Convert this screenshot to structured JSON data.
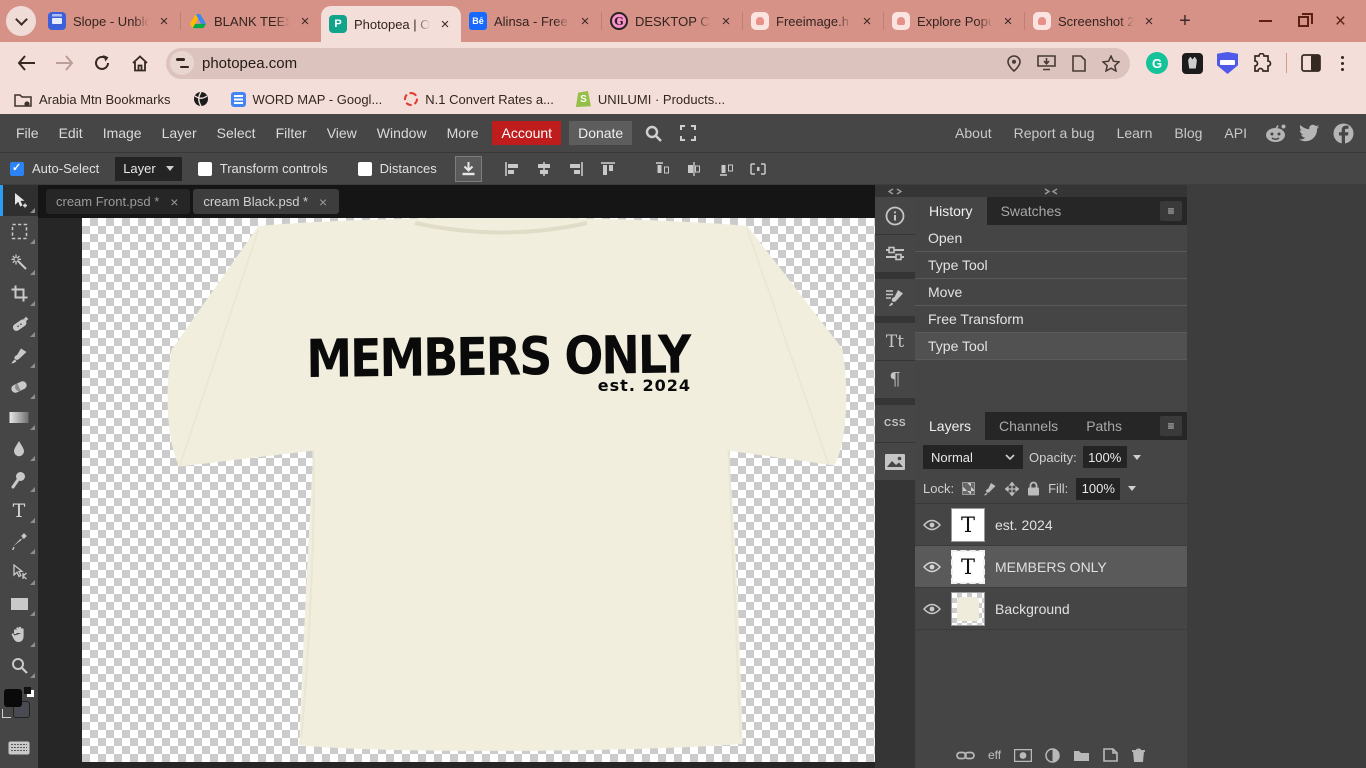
{
  "browser": {
    "tabs": [
      {
        "title": "Slope - Unblo",
        "favicon": "slope"
      },
      {
        "title": "BLANK TEES",
        "favicon": "google-drive"
      },
      {
        "title": "Photopea | O",
        "favicon": "photopea",
        "favicon_letter": "P",
        "active": true
      },
      {
        "title": "Alinsa - Free",
        "favicon": "behance",
        "favicon_letter": "Bē"
      },
      {
        "title": "DESKTOP CO",
        "favicon": "g-circle",
        "favicon_letter": "G"
      },
      {
        "title": "Freeimage.h",
        "favicon": "image"
      },
      {
        "title": "Explore Popu",
        "favicon": "image"
      },
      {
        "title": "Screenshot 2",
        "favicon": "image"
      }
    ],
    "url": "photopea.com",
    "bookmarks": {
      "folder": "Arabia Mtn Bookmarks",
      "items": [
        "WORD MAP - Googl...",
        "N.1 Convert Rates a...",
        "UNILUMI · Products..."
      ],
      "shopify_letter": "S"
    },
    "grammarly_letter": "G"
  },
  "menu": {
    "items": [
      "File",
      "Edit",
      "Image",
      "Layer",
      "Select",
      "Filter",
      "View",
      "Window",
      "More"
    ],
    "account": "Account",
    "donate": "Donate",
    "links": [
      "About",
      "Report a bug",
      "Learn",
      "Blog",
      "API"
    ]
  },
  "options": {
    "auto_select": "Auto-Select",
    "layer_select": "Layer",
    "transform_controls": "Transform controls",
    "distances": "Distances"
  },
  "doc_tabs": [
    {
      "name": "cream Front.psd *"
    },
    {
      "name": "cream Black.psd *",
      "active": true
    }
  ],
  "canvas": {
    "shirt_title": "MEMBERS ONLY",
    "shirt_subtitle": "est. 2024",
    "shirt_color": "#f1eedd"
  },
  "tools_panel": {
    "type_tool_letter": "T",
    "char_panel_label": "Tt",
    "paragraph_label": "¶",
    "css_label": "CSS"
  },
  "history": {
    "tabs": [
      "History",
      "Swatches"
    ],
    "items": [
      "Open",
      "Type Tool",
      "Move",
      "Free Transform",
      "Type Tool"
    ],
    "selected_index": 4
  },
  "layers": {
    "tabs": [
      "Layers",
      "Channels",
      "Paths"
    ],
    "blend_mode": "Normal",
    "opacity_label": "Opacity:",
    "opacity": "100%",
    "lock_label": "Lock:",
    "fill_label": "Fill:",
    "fill": "100%",
    "effects_label": "eff",
    "items": [
      {
        "name": "est. 2024",
        "thumb_letter": "T"
      },
      {
        "name": "MEMBERS ONLY",
        "thumb_letter": "T",
        "selected": true
      },
      {
        "name": "Background"
      }
    ]
  },
  "colors": {
    "accent_blue": "#2b83f6",
    "account_red": "#bf1d1d",
    "frame_salmon": "#d69287",
    "toolbar_pink": "#f3ded9"
  }
}
